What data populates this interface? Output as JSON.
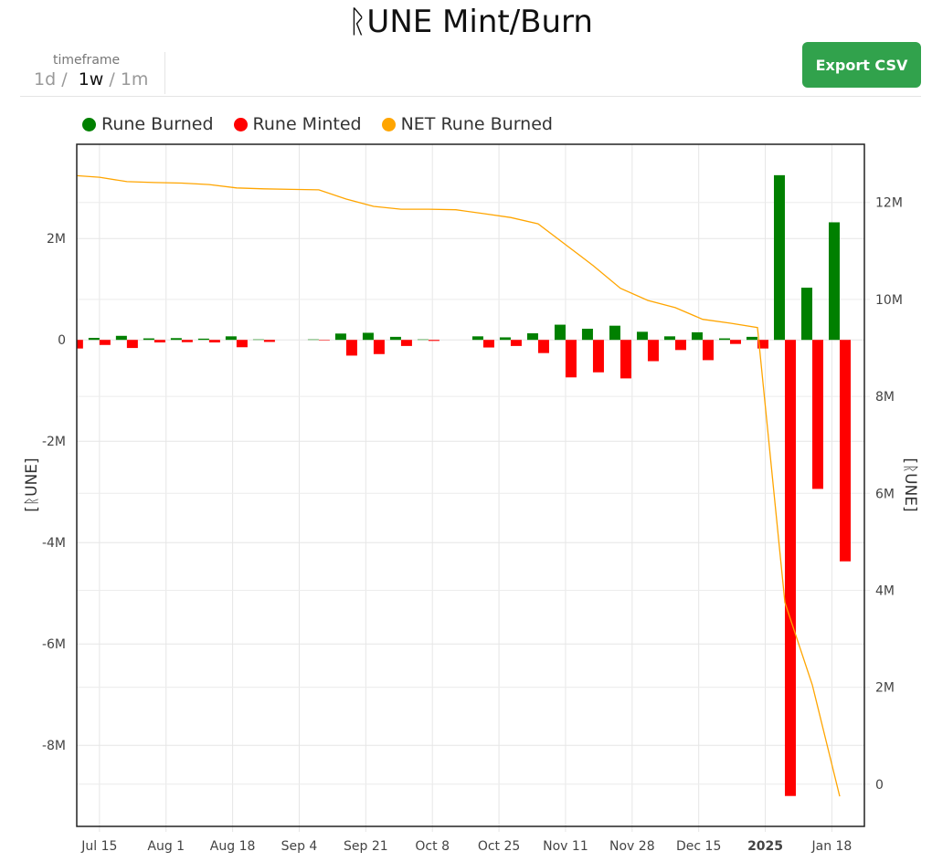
{
  "title": "ᚱUNE Mint/Burn",
  "timeframe": {
    "label": "timeframe",
    "options": [
      "1d",
      "1w",
      "1m"
    ],
    "separator": "/",
    "selected": "1w"
  },
  "toolbar": {
    "export_label": "Export CSV"
  },
  "colors": {
    "burned": "#008000",
    "minted": "#ff0000",
    "net": "#ffa500",
    "export_button": "#31a24c"
  },
  "chart_data": {
    "type": "bar+line",
    "title": "ᚱUNE Mint/Burn",
    "x_unit": "days since 2024-07-08 (weekly buckets)",
    "x": [
      0,
      7,
      14,
      21,
      28,
      35,
      42,
      49,
      56,
      63,
      70,
      77,
      84,
      91,
      98,
      105,
      112,
      119,
      126,
      133,
      140,
      147,
      154,
      161,
      168,
      175,
      182,
      189,
      196
    ],
    "xlim": [
      1.2,
      202.3
    ],
    "x_ticks": [
      {
        "day": 7,
        "label": "Jul 15"
      },
      {
        "day": 24,
        "label": "Aug 1"
      },
      {
        "day": 41,
        "label": "Aug 18"
      },
      {
        "day": 58,
        "label": "Sep 4"
      },
      {
        "day": 75,
        "label": "Sep 21"
      },
      {
        "day": 92,
        "label": "Oct 8"
      },
      {
        "day": 109,
        "label": "Oct 25"
      },
      {
        "day": 126,
        "label": "Nov 11"
      },
      {
        "day": 143,
        "label": "Nov 28"
      },
      {
        "day": 160,
        "label": "Dec 15"
      },
      {
        "day": 177,
        "label": "2025",
        "bold": true
      },
      {
        "day": 194,
        "label": "Jan 18"
      }
    ],
    "legend": [
      "Rune Burned",
      "Rune Minted",
      "NET Rune Burned"
    ],
    "legend_position": "top-left",
    "y_left": {
      "label": "[ᚱUNE]",
      "lim": [
        -9.6,
        3.86
      ],
      "ticks": [
        2,
        0,
        -2,
        -4,
        -6,
        -8
      ],
      "tick_labels": [
        "2M",
        "0",
        "-2M",
        "-4M",
        "-6M",
        "-8M"
      ]
    },
    "y_right": {
      "label": "[ᚱUNE]",
      "lim": [
        -0.87,
        13.2
      ],
      "ticks": [
        12,
        10,
        8,
        6,
        4,
        2,
        0
      ],
      "tick_labels": [
        "12M",
        "10M",
        "8M",
        "6M",
        "4M",
        "2M",
        "0"
      ]
    },
    "series": [
      {
        "name": "Rune Burned",
        "axis": "left",
        "kind": "bar",
        "unit": "M",
        "values": [
          0.02,
          0.04,
          0.08,
          0.03,
          0.035,
          0.025,
          0.07,
          0.01,
          0,
          0.01,
          0.125,
          0.14,
          0.06,
          0.01,
          0,
          0.07,
          0.05,
          0.13,
          0.3,
          0.22,
          0.28,
          0.16,
          0.07,
          0.15,
          0.03,
          0.06,
          3.25,
          1.03,
          2.32
        ]
      },
      {
        "name": "Rune Minted",
        "axis": "left",
        "kind": "bar",
        "unit": "M",
        "values": [
          -0.17,
          -0.1,
          -0.16,
          -0.05,
          -0.045,
          -0.05,
          -0.145,
          -0.04,
          0,
          -0.01,
          -0.31,
          -0.28,
          -0.12,
          -0.02,
          0,
          -0.15,
          -0.12,
          -0.26,
          -0.74,
          -0.64,
          -0.76,
          -0.42,
          -0.2,
          -0.4,
          -0.08,
          -0.17,
          -9.0,
          -2.94,
          -4.37
        ]
      },
      {
        "name": "NET Rune Burned",
        "axis": "right",
        "kind": "line",
        "unit": "M",
        "values": [
          12.56,
          12.52,
          12.43,
          12.41,
          12.4,
          12.37,
          12.3,
          12.28,
          12.27,
          12.26,
          12.07,
          11.92,
          11.86,
          11.86,
          11.85,
          11.77,
          11.69,
          11.56,
          11.13,
          10.7,
          10.23,
          9.98,
          9.83,
          9.59,
          9.51,
          9.42,
          3.75,
          2.05,
          -0.25
        ]
      }
    ],
    "grid": true
  }
}
